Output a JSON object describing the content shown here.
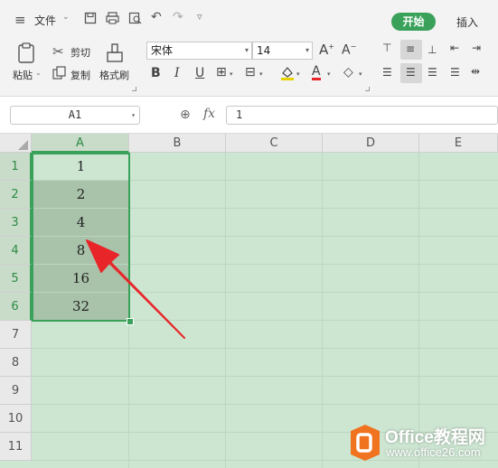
{
  "titlebar": {
    "menu_label": "文件",
    "start_tab": "开始",
    "insert_tab": "插入"
  },
  "ribbon": {
    "paste": "粘贴",
    "cut": "剪切",
    "copy": "复制",
    "format_painter": "格式刷",
    "font_name": "宋体",
    "font_size": "14"
  },
  "formula_bar": {
    "name_box": "A1",
    "fx": "fx",
    "value": "1"
  },
  "grid": {
    "columns": [
      "A",
      "B",
      "C",
      "D",
      "E"
    ],
    "rows": [
      "1",
      "2",
      "3",
      "4",
      "5",
      "6",
      "7",
      "8",
      "9",
      "10",
      "11"
    ],
    "column_a_values": [
      "1",
      "2",
      "4",
      "8",
      "16",
      "32"
    ]
  },
  "watermark": {
    "brand": "Office教程网",
    "url": "www.office26.com"
  },
  "colors": {
    "accent_green": "#3aa15a",
    "grid_background": "#cde6d2",
    "selection_shade": "#a9c3aa",
    "arrow_red": "#e8262a",
    "logo_orange": "#f0731f"
  }
}
